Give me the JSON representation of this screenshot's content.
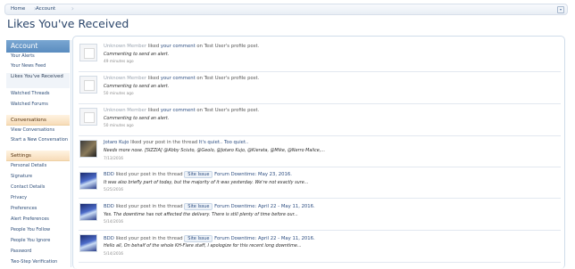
{
  "breadcrumb": {
    "items": [
      "Home",
      "Account"
    ]
  },
  "page": {
    "title": "Likes You've Received"
  },
  "sidebar": {
    "account_header": "Account",
    "account_items": [
      "Your Alerts",
      "Your News Feed",
      "Likes You've Received",
      "Watched Threads",
      "Watched Forums"
    ],
    "conversations_header": "Conversations",
    "conversation_items": [
      "View Conversations",
      "Start a New Conversation"
    ],
    "settings_header": "Settings",
    "settings_items": [
      "Personal Details",
      "Signature",
      "Contact Details",
      "Privacy",
      "Preferences",
      "Alert Preferences",
      "People You Follow",
      "People You Ignore",
      "Password",
      "Two-Step Verification"
    ]
  },
  "likes": [
    {
      "user": "Unknown Member",
      "verb": "liked",
      "link": "your comment",
      "rest": "on Test User's profile post.",
      "snippet": "Commenting to send an alert.",
      "time": "49 minutes ago",
      "avatar": "blank"
    },
    {
      "user": "Unknown Member",
      "verb": "liked",
      "link": "your comment",
      "rest": "on Test User's profile post.",
      "snippet": "Commenting to send an alert.",
      "time": "50 minutes ago",
      "avatar": "blank"
    },
    {
      "user": "Unknown Member",
      "verb": "liked",
      "link": "your comment",
      "rest": "on Test User's profile post.",
      "snippet": "Commenting to send an alert.",
      "time": "50 minutes ago",
      "avatar": "blank"
    },
    {
      "user": "Jotaro Kujo",
      "verb": "liked your post in the thread",
      "link": "It's quiet.. Too quiet..",
      "snippet": "Needs more nose. [SIZZIA] @Abby Sciuto, @Geolo, @Jotaro Kujo, @Kierata, @Mike, @Nerro Malice,...",
      "time": "7/13/2016",
      "avatar": "jotaro"
    },
    {
      "user": "BDD",
      "verb": "liked your post in the thread",
      "tag": "Site Issue",
      "link": "Forum Downtime: May 23, 2016.",
      "snippet": "It was also briefly part of today, but the majority of it was yesterday. We're not exactly sure...",
      "time": "5/25/2016",
      "avatar": "bdd"
    },
    {
      "user": "BDD",
      "verb": "liked your post in the thread",
      "tag": "Site Issue",
      "link": "Forum Downtime: April 22 - May 11, 2016.",
      "snippet": "Yes. The downtime has not affected the delivery. There is still plenty of time before our...",
      "time": "5/14/2016",
      "avatar": "bdd"
    },
    {
      "user": "BDD",
      "verb": "liked your post in the thread",
      "tag": "Site Issue",
      "link": "Forum Downtime: April 22 - May 11, 2016.",
      "snippet": "Hello all, On behalf of the whole KH-Flare staff, I apologize for this recent long downtime...",
      "time": "5/14/2016",
      "avatar": "bdd"
    }
  ]
}
